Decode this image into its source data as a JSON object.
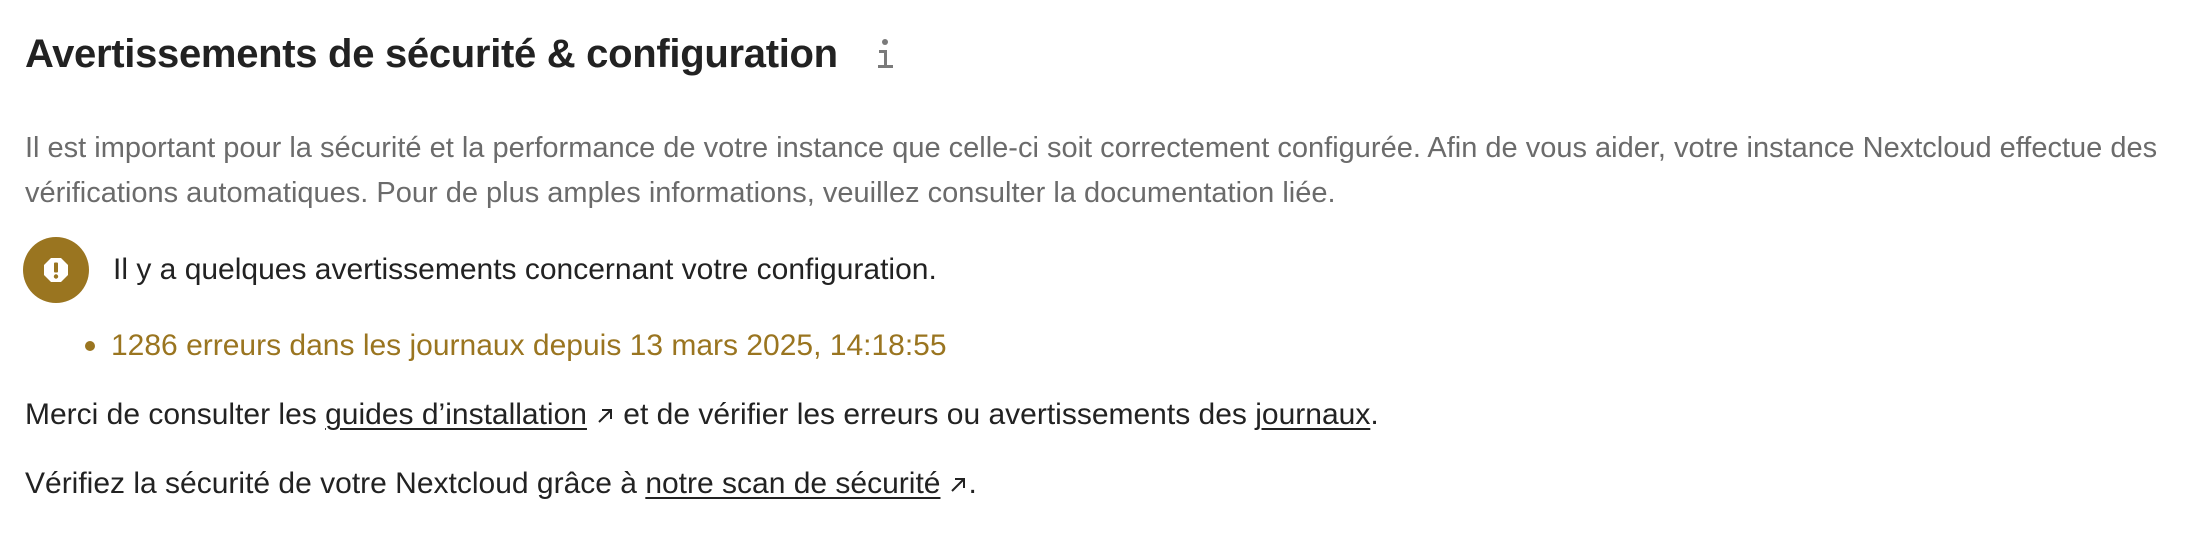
{
  "section": {
    "title": "Avertissements de sécurité & configuration",
    "info_icon": "info-icon",
    "description": "Il est important pour la sécurité et la performance de votre instance que celle-ci soit correctement configurée. Afin de vous aider, votre instance Nextcloud effectue des vérifications automatiques. Pour de plus amples informations, veuillez consulter la documentation liée."
  },
  "warning": {
    "icon": "alert-circle-icon",
    "text": "Il y a quelques avertissements concernant votre configuration.",
    "color": "#9a7520"
  },
  "errors": [
    "1286 erreurs dans les journaux depuis 13 mars 2025, 14:18:55"
  ],
  "guides_line": {
    "prefix": "Merci de consulter les ",
    "guides_link": "guides d’installation",
    "middle": " et de vérifier les erreurs ou avertissements des ",
    "logs_link": "journaux",
    "suffix": "."
  },
  "scan_line": {
    "prefix": "Vérifiez la sécurité de votre Nextcloud grâce à ",
    "scan_link": "notre scan de sécurité",
    "suffix": "."
  }
}
